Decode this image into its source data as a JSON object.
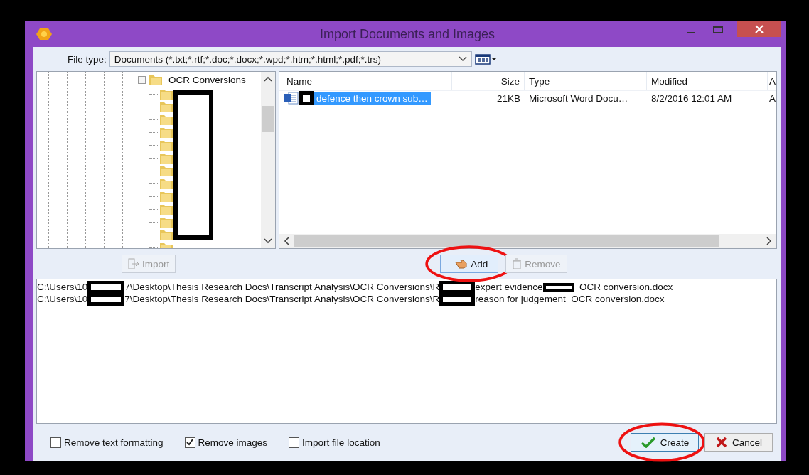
{
  "window": {
    "title": "Import Documents and Images"
  },
  "file_type": {
    "label": "File type:",
    "value": "Documents (*.txt;*.rtf;*.doc;*.docx;*.wpd;*.htm;*.html;*.pdf;*.trs)"
  },
  "tree": [
    {
      "label": "OCR Conversions",
      "expanded": true,
      "children": [
        {
          "kind": "folder"
        },
        {
          "kind": "folder"
        },
        {
          "kind": "folder"
        },
        {
          "kind": "folder"
        },
        {
          "kind": "folder"
        },
        {
          "kind": "folder"
        },
        {
          "kind": "folder"
        },
        {
          "kind": "folder"
        },
        {
          "kind": "folder"
        },
        {
          "kind": "folder"
        },
        {
          "kind": "folder"
        },
        {
          "kind": "folder"
        },
        {
          "kind": "folder"
        }
      ]
    }
  ],
  "files": {
    "columns": [
      "Name",
      "Size",
      "Type",
      "Modified",
      "A"
    ],
    "rows": [
      {
        "selected": true,
        "cells": [
          "defence then crown sub…",
          "21KB",
          "Microsoft Word Docu…",
          "8/2/2016 12:01 AM",
          "A"
        ]
      }
    ]
  },
  "buttons": [
    {
      "label": "Import",
      "disabled": true,
      "highlighted": false
    },
    {
      "label": "Add",
      "disabled": false,
      "highlighted": true
    },
    {
      "label": "Remove",
      "disabled": true,
      "highlighted": false
    }
  ],
  "selected_paths": [
    {
      "parts": [
        {
          "kind": "text",
          "text": "C:\\Users\\10"
        },
        {
          "kind": "redacted"
        },
        {
          "kind": "text",
          "text": "7\\Desktop\\Thesis Research Docs\\Transcript Analysis\\OCR Conversions\\R"
        },
        {
          "kind": "redacted"
        },
        {
          "kind": "text",
          "text": "expert evidence"
        },
        {
          "kind": "redacted"
        },
        {
          "kind": "text",
          "text": "_OCR conversion.docx"
        }
      ]
    },
    {
      "parts": [
        {
          "kind": "text",
          "text": "C:\\Users\\10"
        },
        {
          "kind": "redacted"
        },
        {
          "kind": "text",
          "text": "7\\Desktop\\Thesis Research Docs\\Transcript Analysis\\OCR Conversions\\R"
        },
        {
          "kind": "redacted"
        },
        {
          "kind": "text",
          "text": "reason for judgement_OCR conversion.docx"
        }
      ]
    }
  ],
  "options": [
    {
      "label": "Remove text formatting",
      "checked": false
    },
    {
      "label": "Remove images",
      "checked": true
    },
    {
      "label": "Import file location",
      "checked": false
    }
  ],
  "actions": [
    {
      "label": "Create",
      "kind": "ok",
      "highlighted": true
    },
    {
      "label": "Cancel",
      "kind": "cancel",
      "highlighted": false
    }
  ]
}
